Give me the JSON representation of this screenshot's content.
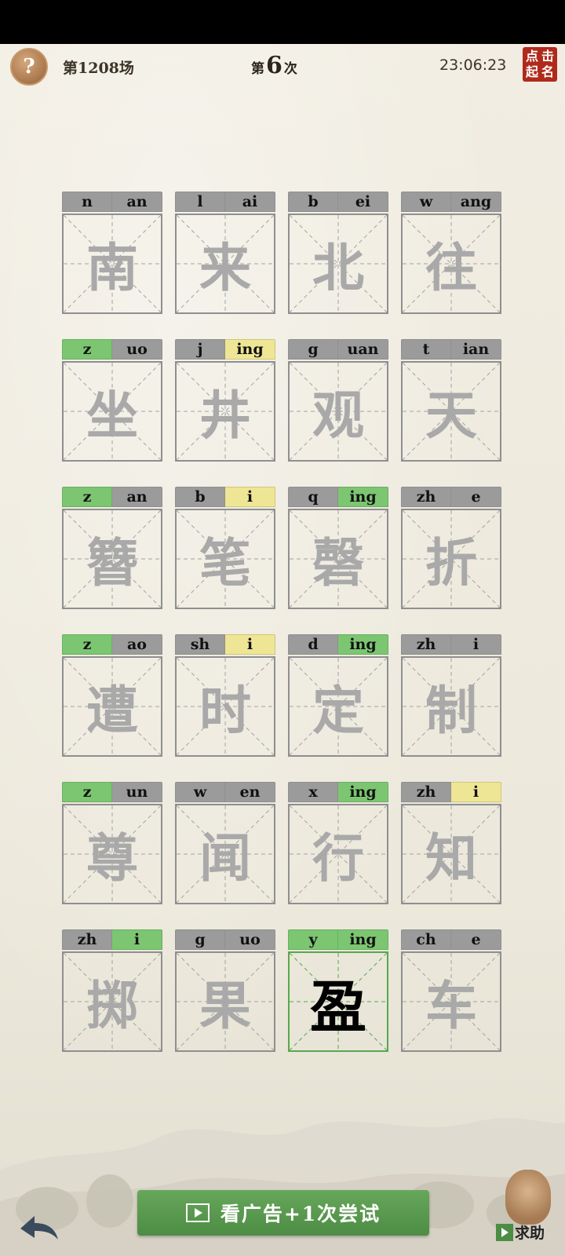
{
  "header": {
    "help_icon": "?",
    "round": "第1208场",
    "attempt_prefix": "第",
    "attempt_number": "6",
    "attempt_suffix": "次",
    "time": "23:06:23",
    "seal_chars": [
      "点",
      "击",
      "起",
      "名"
    ]
  },
  "grid": {
    "columns": 4,
    "cells": [
      {
        "initial": "n",
        "final": "an",
        "char": "南",
        "initial_state": "gray",
        "final_state": "gray"
      },
      {
        "initial": "l",
        "final": "ai",
        "char": "来",
        "initial_state": "gray",
        "final_state": "gray"
      },
      {
        "initial": "b",
        "final": "ei",
        "char": "北",
        "initial_state": "gray",
        "final_state": "gray"
      },
      {
        "initial": "w",
        "final": "ang",
        "char": "往",
        "initial_state": "gray",
        "final_state": "gray"
      },
      {
        "initial": "z",
        "final": "uo",
        "char": "坐",
        "initial_state": "green",
        "final_state": "gray"
      },
      {
        "initial": "j",
        "final": "ing",
        "char": "井",
        "initial_state": "gray",
        "final_state": "yellow"
      },
      {
        "initial": "g",
        "final": "uan",
        "char": "观",
        "initial_state": "gray",
        "final_state": "gray"
      },
      {
        "initial": "t",
        "final": "ian",
        "char": "天",
        "initial_state": "gray",
        "final_state": "gray"
      },
      {
        "initial": "z",
        "final": "an",
        "char": "簪",
        "initial_state": "green",
        "final_state": "gray"
      },
      {
        "initial": "b",
        "final": "i",
        "char": "笔",
        "initial_state": "gray",
        "final_state": "yellow"
      },
      {
        "initial": "q",
        "final": "ing",
        "char": "磬",
        "initial_state": "gray",
        "final_state": "green"
      },
      {
        "initial": "zh",
        "final": "e",
        "char": "折",
        "initial_state": "gray",
        "final_state": "gray"
      },
      {
        "initial": "z",
        "final": "ao",
        "char": "遭",
        "initial_state": "green",
        "final_state": "gray"
      },
      {
        "initial": "sh",
        "final": "i",
        "char": "时",
        "initial_state": "gray",
        "final_state": "yellow"
      },
      {
        "initial": "d",
        "final": "ing",
        "char": "定",
        "initial_state": "gray",
        "final_state": "green"
      },
      {
        "initial": "zh",
        "final": "i",
        "char": "制",
        "initial_state": "gray",
        "final_state": "gray"
      },
      {
        "initial": "z",
        "final": "un",
        "char": "尊",
        "initial_state": "green",
        "final_state": "gray"
      },
      {
        "initial": "w",
        "final": "en",
        "char": "闻",
        "initial_state": "gray",
        "final_state": "gray"
      },
      {
        "initial": "x",
        "final": "ing",
        "char": "行",
        "initial_state": "gray",
        "final_state": "green"
      },
      {
        "initial": "zh",
        "final": "i",
        "char": "知",
        "initial_state": "gray",
        "final_state": "yellow"
      },
      {
        "initial": "zh",
        "final": "i",
        "char": "掷",
        "initial_state": "gray",
        "final_state": "green"
      },
      {
        "initial": "g",
        "final": "uo",
        "char": "果",
        "initial_state": "gray",
        "final_state": "gray"
      },
      {
        "initial": "y",
        "final": "ing",
        "char": "盈",
        "initial_state": "green",
        "final_state": "green",
        "active": true
      },
      {
        "initial": "ch",
        "final": "e",
        "char": "车",
        "initial_state": "gray",
        "final_state": "gray"
      }
    ]
  },
  "footer": {
    "ad_label": "看广告+1次尝试",
    "ad_icon": "video-play-icon",
    "back_icon": "back-arrow-icon",
    "helper_label": "求助"
  }
}
